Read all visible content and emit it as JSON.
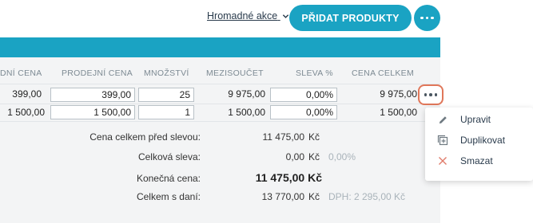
{
  "toolbar": {
    "bulk_actions_label": "Hromadné akce",
    "add_products_label": "PŘIDAT PRODUKTY"
  },
  "table": {
    "headers": [
      "DNÍ CENA",
      "PRODEJNÍ CENA",
      "MNOŽSTVÍ",
      "MEZISOUČET",
      "SLEVA %",
      "CENA CELKEM"
    ],
    "rows": [
      {
        "buy_price": "399,00",
        "sell_price": "399,00",
        "quantity": "25",
        "subtotal": "9 975,00",
        "discount": "0,00%",
        "total": "9 975,00"
      },
      {
        "buy_price": "1 500,00",
        "sell_price": "1 500,00",
        "quantity": "1",
        "subtotal": "1 500,00",
        "discount": "0,00%",
        "total": "1 500,00"
      }
    ]
  },
  "summary": {
    "before_discount_label": "Cena celkem před slevou:",
    "before_discount_value": "11 475,00",
    "discount_label": "Celková sleva:",
    "discount_value": "0,00",
    "discount_percent": "0,00%",
    "final_label": "Konečná cena:",
    "final_value": "11 475,00 Kč",
    "with_tax_label": "Celkem s daní:",
    "with_tax_value": "13 770,00",
    "tax_note": "DPH: 2 295,00 Kč",
    "currency": "Kč"
  },
  "menu": {
    "items": [
      {
        "label": "Upravit",
        "icon": "pencil-icon"
      },
      {
        "label": "Duplikovat",
        "icon": "duplicate-icon"
      },
      {
        "label": "Smazat",
        "icon": "close-icon"
      }
    ]
  },
  "colors": {
    "accent": "#1aa3c3",
    "highlight": "#e0775a",
    "delete": "#e07b6a"
  }
}
